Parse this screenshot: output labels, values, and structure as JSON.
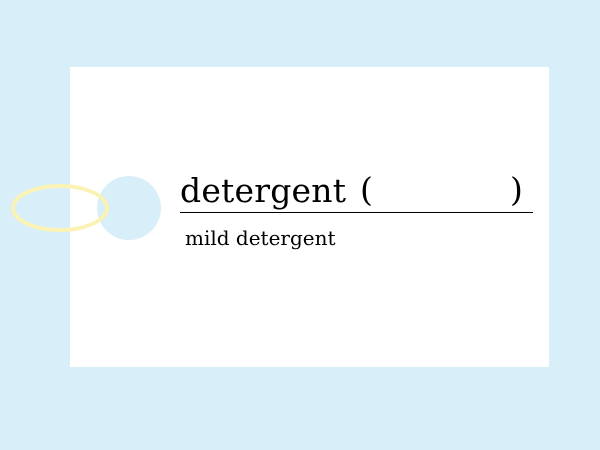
{
  "card": {
    "word": "detergent",
    "open_paren": "(",
    "close_paren": ")",
    "example_phrase": "mild detergent"
  },
  "colors": {
    "background": "#d8eef9",
    "card": "#ffffff",
    "hole": "#d8eef9",
    "string": "#fbf3b5",
    "text": "#000000"
  },
  "icons": {
    "tag_string": "loop-string-icon",
    "tag_hole": "punched-hole-icon"
  }
}
